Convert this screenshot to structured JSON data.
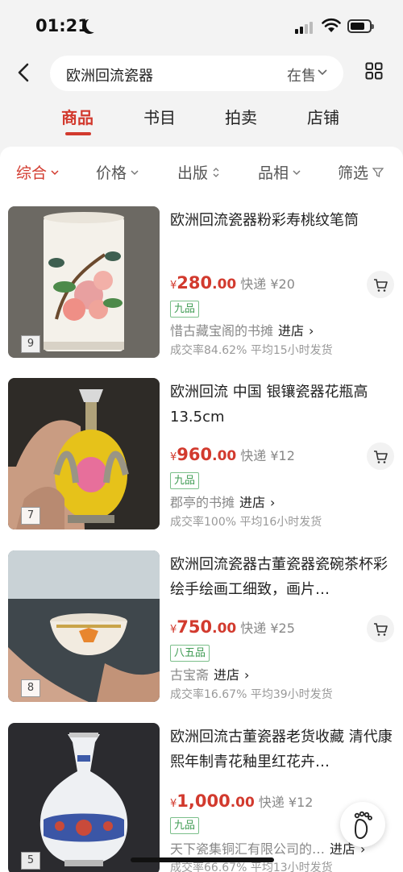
{
  "status": {
    "time": "01:21"
  },
  "search": {
    "query": "欧洲回流瓷器",
    "filter": "在售"
  },
  "tabs": [
    "商品",
    "书目",
    "拍卖",
    "店铺"
  ],
  "sorts": [
    "综合",
    "价格",
    "出版",
    "品相",
    "筛选"
  ],
  "items": [
    {
      "title": "欧洲回流瓷器粉彩寿桃纹笔筒",
      "currency": "¥",
      "price_int": "280",
      "price_dec": ".00",
      "shipping": "快递 ¥20",
      "condition": "九品",
      "shop": "惜古藏宝阁的书摊",
      "enter": "进店",
      "stats": "成交率84.62%  平均15小时发货",
      "img_count": "9"
    },
    {
      "title": "欧洲回流 中国 银镶瓷器花瓶高13.5cm",
      "currency": "¥",
      "price_int": "960",
      "price_dec": ".00",
      "shipping": "快递 ¥12",
      "condition": "九品",
      "shop": "郡亭的书摊",
      "enter": "进店",
      "stats": "成交率100%  平均16小时发货",
      "img_count": "7"
    },
    {
      "title": "欧洲回流瓷器古董瓷器瓷碗茶杯彩绘手绘画工细致，画片…",
      "currency": "¥",
      "price_int": "750",
      "price_dec": ".00",
      "shipping": "快递 ¥25",
      "condition": "八五品",
      "shop": "古宝斋",
      "enter": "进店",
      "stats": "成交率16.67%  平均39小时发货",
      "img_count": "8"
    },
    {
      "title": "欧洲回流古董瓷器老货收藏 清代康熙年制青花釉里红花卉…",
      "currency": "¥",
      "price_int": "1,000",
      "price_dec": ".00",
      "shipping": "快递 ¥12",
      "condition": "九品",
      "shop": "天下瓷集铜汇有限公司的…",
      "enter": "进店",
      "stats": "成交率66.67%  平均13小时发货",
      "img_count": "5"
    }
  ],
  "colors": {
    "accent": "#d23a2e",
    "condition": "#3f9b53"
  }
}
